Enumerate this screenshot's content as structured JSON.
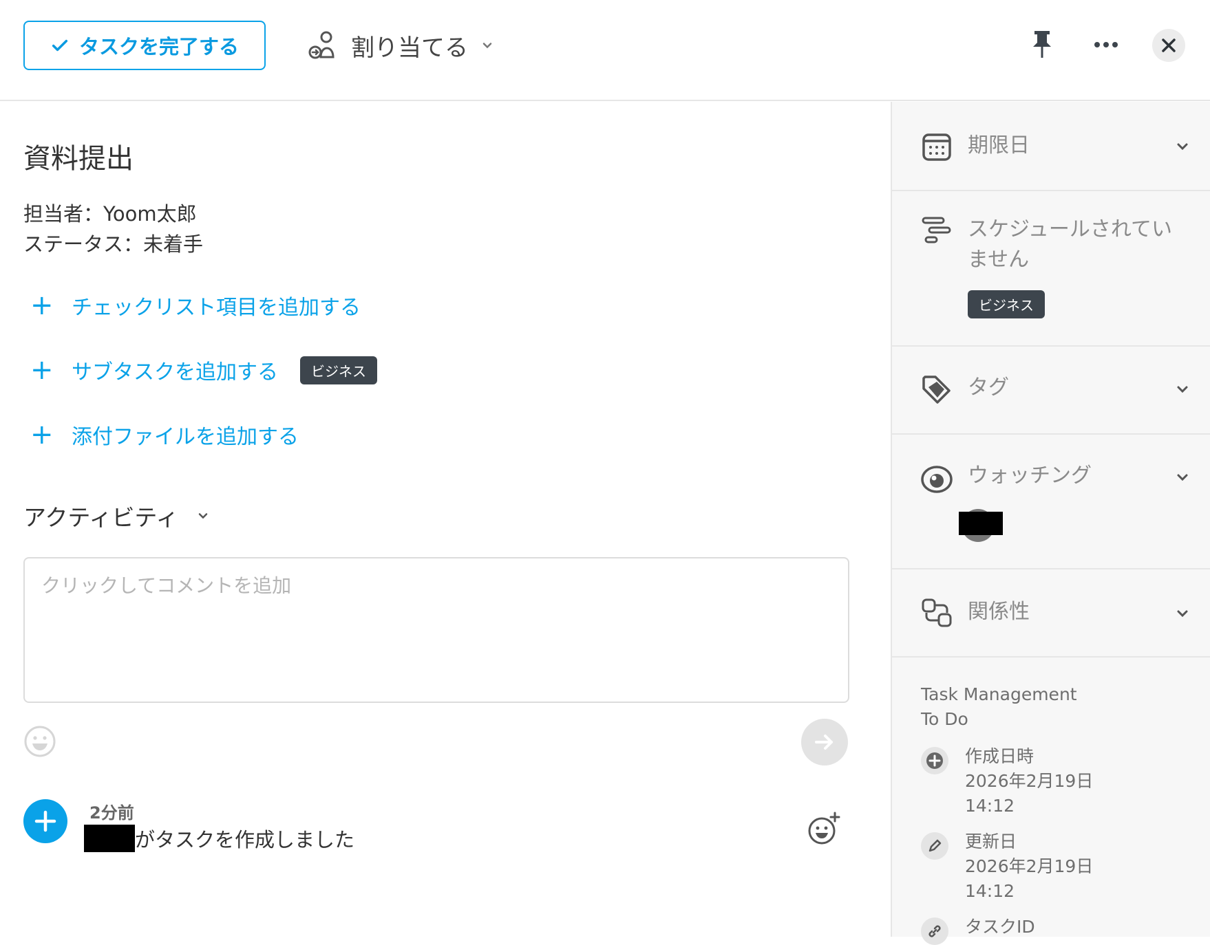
{
  "header": {
    "complete_label": "タスクを完了する",
    "assign_label": "割り当てる"
  },
  "task": {
    "title": "資料提出",
    "assignee_line": "担当者：Yoom太郎",
    "status_line": "ステータス：未着手"
  },
  "actions": {
    "add_checklist": "チェックリスト項目を追加する",
    "add_subtask": "サブタスクを追加する",
    "subtask_badge": "ビジネス",
    "add_attachment": "添付ファイルを追加する",
    "plus": "+"
  },
  "activity": {
    "title": "アクティビティ",
    "comment_placeholder": "クリックしてコメントを追加",
    "feed": {
      "time": "2分前",
      "text": "がタスクを作成しました"
    }
  },
  "sidebar": {
    "due_date": "期限日",
    "schedule_line1": "スケジュールされてい",
    "schedule_line2": "ません",
    "schedule_badge": "ビジネス",
    "tags": "タグ",
    "watching": "ウォッチング",
    "relations": "関係性",
    "project": "Task Management",
    "list": "To Do",
    "created_label": "作成日時",
    "created_date": "2026年2月19日",
    "created_time": "14:12",
    "updated_label": "更新日",
    "updated_date": "2026年2月19日",
    "updated_time": "14:12",
    "task_id_label": "タスクID"
  },
  "colors": {
    "accent": "#0aa2e8",
    "badge_bg": "#3d454d"
  }
}
